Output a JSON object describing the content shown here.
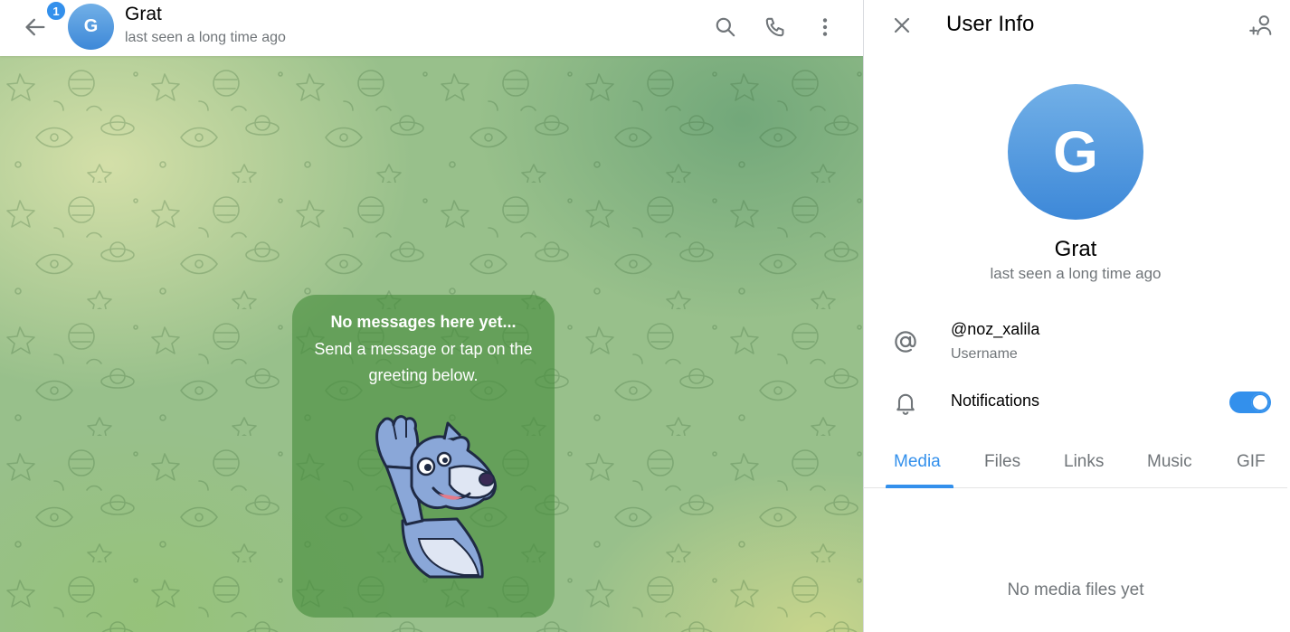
{
  "header": {
    "unread_count": "1",
    "avatar_initial": "G",
    "name": "Grat",
    "status": "last seen a long time ago"
  },
  "chat": {
    "empty_title": "No messages here yet...",
    "empty_text": "Send a message or tap on the greeting below."
  },
  "info_panel": {
    "title": "User Info",
    "avatar_initial": "G",
    "name": "Grat",
    "status": "last seen a long time ago",
    "username": "@noz_xalila",
    "username_caption": "Username",
    "notifications_label": "Notifications",
    "notifications_enabled": true,
    "tabs": [
      {
        "label": "Media",
        "active": true
      },
      {
        "label": "Files",
        "active": false
      },
      {
        "label": "Links",
        "active": false
      },
      {
        "label": "Music",
        "active": false
      },
      {
        "label": "GIF",
        "active": false
      }
    ],
    "empty_media": "No media files yet"
  },
  "colors": {
    "accent": "#3390ec",
    "secondary_text": "#707579",
    "chat_background": "#98c08b",
    "empty_card": "#468c3c"
  },
  "icons": [
    "back-arrow-icon",
    "search-icon",
    "phone-icon",
    "more-vertical-icon",
    "close-icon",
    "add-contact-icon",
    "at-sign-icon",
    "bell-icon"
  ]
}
